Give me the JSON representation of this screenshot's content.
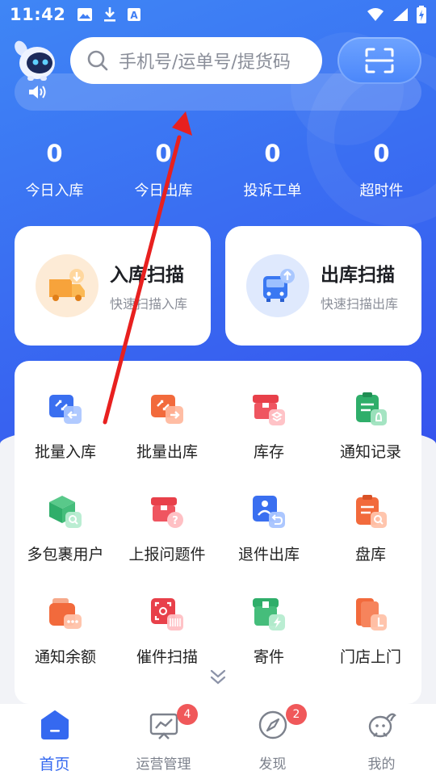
{
  "status_bar": {
    "time": "11:42",
    "left_icons": [
      "image-icon",
      "download-icon",
      "text-icon"
    ],
    "right_icons": [
      "wifi-icon",
      "signal-icon",
      "battery-icon"
    ]
  },
  "header": {
    "search_placeholder": "手机号/运单号/提货码",
    "scan_button_icon": "scan-icon",
    "notice_icon": "speaker-icon"
  },
  "stats": [
    {
      "value": "0",
      "label": "今日入库"
    },
    {
      "value": "0",
      "label": "今日出库"
    },
    {
      "value": "0",
      "label": "投诉工单"
    },
    {
      "value": "0",
      "label": "超时件"
    }
  ],
  "scan_cards": [
    {
      "title": "入库扫描",
      "subtitle": "快速扫描入库",
      "icon": "truck-in-icon"
    },
    {
      "title": "出库扫描",
      "subtitle": "快速扫描出库",
      "icon": "bus-out-icon"
    }
  ],
  "grid_items": [
    {
      "label": "批量入库",
      "icon": "batch-in-icon"
    },
    {
      "label": "批量出库",
      "icon": "batch-out-icon"
    },
    {
      "label": "库存",
      "icon": "inventory-icon"
    },
    {
      "label": "通知记录",
      "icon": "notice-record-icon"
    },
    {
      "label": "多包裹用户",
      "icon": "multi-package-icon"
    },
    {
      "label": "上报问题件",
      "icon": "report-problem-icon"
    },
    {
      "label": "退件出库",
      "icon": "return-out-icon"
    },
    {
      "label": "盘库",
      "icon": "stocktake-icon"
    },
    {
      "label": "通知余额",
      "icon": "notice-balance-icon"
    },
    {
      "label": "催件扫描",
      "icon": "urge-scan-icon"
    },
    {
      "label": "寄件",
      "icon": "send-package-icon"
    },
    {
      "label": "门店上门",
      "icon": "store-visit-icon"
    }
  ],
  "bottom_nav": [
    {
      "label": "首页",
      "icon": "home-icon",
      "active": true,
      "badge": ""
    },
    {
      "label": "运营管理",
      "icon": "chart-board-icon",
      "active": false,
      "badge": "4"
    },
    {
      "label": "发现",
      "icon": "compass-icon",
      "active": false,
      "badge": "2"
    },
    {
      "label": "我的",
      "icon": "profile-icon",
      "active": false,
      "badge": ""
    }
  ],
  "colors": {
    "primary": "#3569f0",
    "hero_gradient_start": "#3f86f5",
    "hero_gradient_end": "#3553ee",
    "badge": "#f0585a",
    "annotation_arrow": "#e8201f"
  }
}
